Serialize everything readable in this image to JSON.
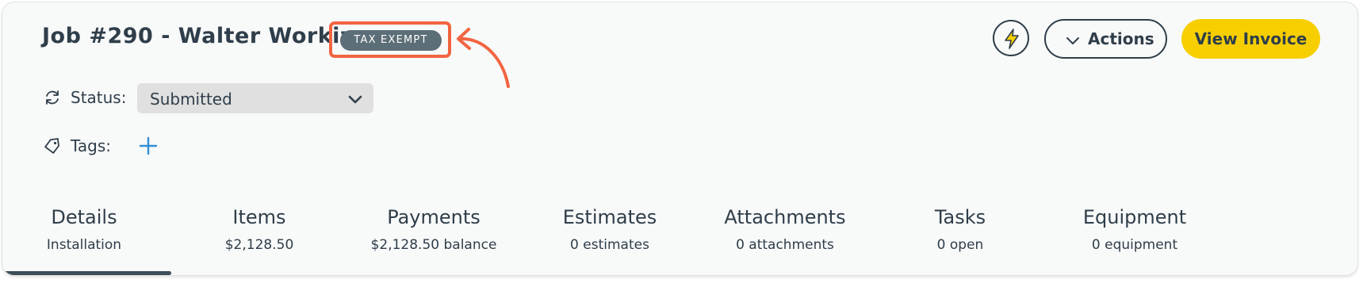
{
  "header": {
    "job_title": "Job #290 - Walter Workiz",
    "tax_badge": "TAX EXEMPT"
  },
  "status": {
    "label": "Status:",
    "selected": "Submitted"
  },
  "tags": {
    "label": "Tags:"
  },
  "toolbar": {
    "actions_label": "Actions",
    "view_invoice_label": "View Invoice"
  },
  "tabs": [
    {
      "title": "Details",
      "subtitle": "Installation"
    },
    {
      "title": "Items",
      "subtitle": "$2,128.50"
    },
    {
      "title": "Payments",
      "subtitle": "$2,128.50 balance"
    },
    {
      "title": "Estimates",
      "subtitle": "0 estimates"
    },
    {
      "title": "Attachments",
      "subtitle": "0 attachments"
    },
    {
      "title": "Tasks",
      "subtitle": "0 open"
    },
    {
      "title": "Equipment",
      "subtitle": "0 equipment"
    }
  ],
  "active_tab": "Details",
  "icons": [
    "sync-icon",
    "tag-icon",
    "plus-icon",
    "lightning-bolt-icon",
    "chevron-down-icon"
  ],
  "colors": {
    "text": "#2f3e4a",
    "badge_bg": "#5c6e77",
    "highlight": "#f26440",
    "primary_button": "#f7cf00",
    "add_tag": "#2f8fd6",
    "bolt": "#f7cf00"
  }
}
